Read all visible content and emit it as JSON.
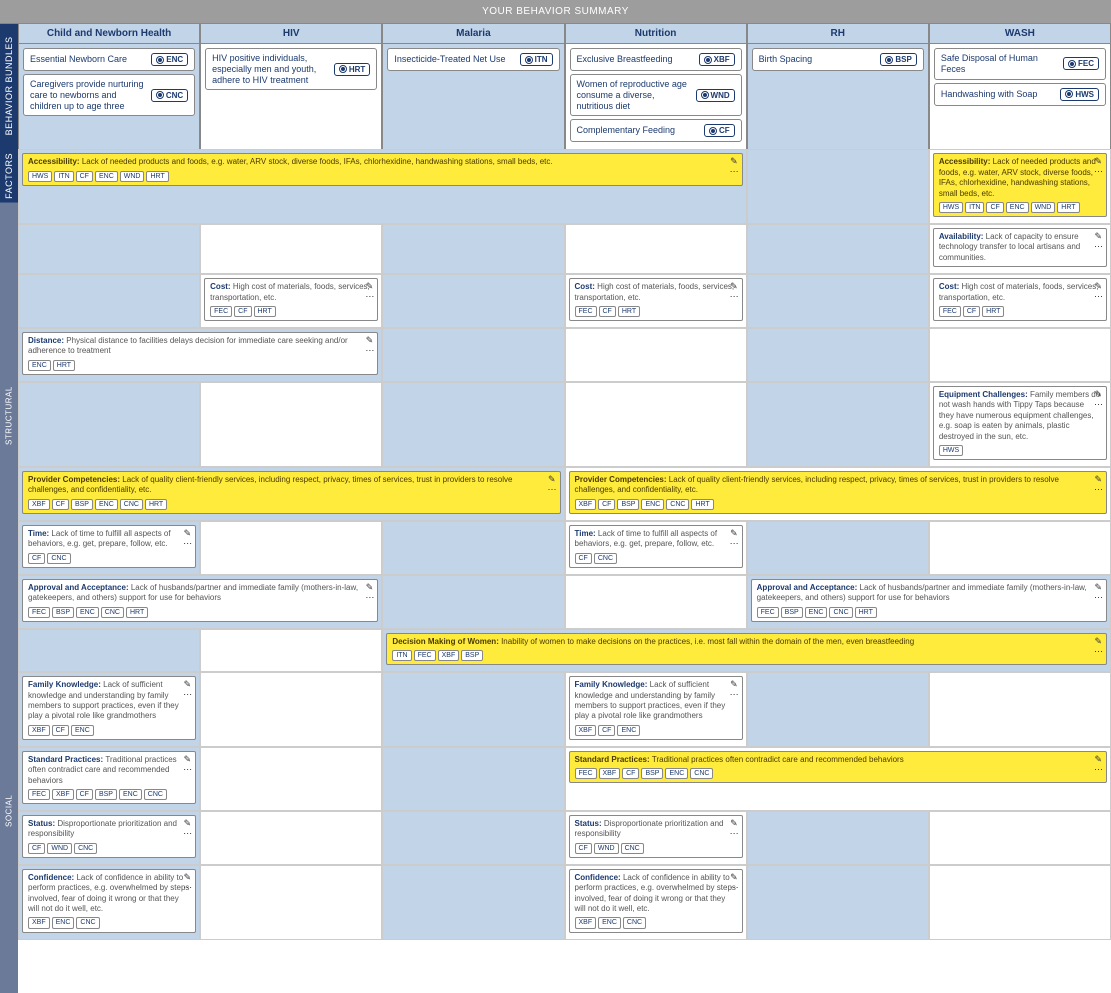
{
  "header": "YOUR BEHAVIOR SUMMARY",
  "side": {
    "bundles": "BEHAVIOR BUNDLES",
    "factors": "FACTORS",
    "structural": "STRUCTURAL",
    "social": "SOCIAL"
  },
  "columns": [
    {
      "name": "Child and Newborn Health",
      "alt": false,
      "bundles": [
        {
          "text": "Essential Newborn Care",
          "code": "ENC"
        },
        {
          "text": "Caregivers provide nurturing care to newborns and children up to age three",
          "code": "CNC"
        }
      ]
    },
    {
      "name": "HIV",
      "alt": true,
      "bundles": [
        {
          "text": "HIV positive individuals, especially men and youth, adhere to HIV treatment",
          "code": "HRT"
        }
      ]
    },
    {
      "name": "Malaria",
      "alt": false,
      "bundles": [
        {
          "text": "Insecticide-Treated Net Use",
          "code": "ITN"
        }
      ]
    },
    {
      "name": "Nutrition",
      "alt": true,
      "bundles": [
        {
          "text": "Exclusive Breastfeeding",
          "code": "XBF"
        },
        {
          "text": "Women of reproductive age consume a diverse, nutritious diet",
          "code": "WND"
        },
        {
          "text": "Complementary Feeding",
          "code": "CF"
        }
      ]
    },
    {
      "name": "RH",
      "alt": false,
      "bundles": [
        {
          "text": "Birth Spacing",
          "code": "BSP"
        }
      ]
    },
    {
      "name": "WASH",
      "alt": true,
      "bundles": [
        {
          "text": "Safe Disposal of Human Feces",
          "code": "FEC"
        },
        {
          "text": "Handwashing with Soap",
          "code": "HWS"
        }
      ]
    }
  ],
  "f": {
    "accessibility": {
      "t": "Accessibility:",
      "d": "Lack of needed products and foods, e.g. water, ARV stock, diverse foods, IFAs, chlorhexidine, handwashing stations, small beds, etc.",
      "tags": [
        "HWS",
        "ITN",
        "CF",
        "ENC",
        "WND",
        "HRT"
      ]
    },
    "availability": {
      "t": "Availability:",
      "d": "Lack of capacity to ensure technology transfer to local artisans and communities."
    },
    "cost": {
      "t": "Cost:",
      "d": "High cost of materials, foods, services, transportation, etc.",
      "tags": [
        "FEC",
        "CF",
        "HRT"
      ]
    },
    "distance": {
      "t": "Distance:",
      "d": "Physical distance to facilities delays decision for immediate care seeking and/or adherence to treatment",
      "tags": [
        "ENC",
        "HRT"
      ]
    },
    "equipment": {
      "t": "Equipment Challenges:",
      "d": "Family members do not wash hands with Tippy Taps because they have numerous equipment challenges, e.g. soap is eaten by animals, plastic destroyed in the sun, etc.",
      "tags": [
        "HWS"
      ]
    },
    "provider": {
      "t": "Provider Competencies:",
      "d": "Lack of quality client-friendly services, including respect, privacy, times of services, trust in providers to resolve challenges, and confidentiality, etc.",
      "tags": [
        "XBF",
        "CF",
        "BSP",
        "ENC",
        "CNC",
        "HRT"
      ]
    },
    "time": {
      "t": "Time:",
      "d": "Lack of time to fulfill all aspects of behaviors, e.g. get, prepare, follow, etc.",
      "tags": [
        "CF",
        "CNC"
      ]
    },
    "approval": {
      "t": "Approval and Acceptance:",
      "d": "Lack of husbands/partner and immediate family (mothers-in-law, gatekeepers, and others) support for use for behaviors",
      "tags": [
        "FEC",
        "BSP",
        "ENC",
        "CNC",
        "HRT"
      ]
    },
    "decision": {
      "t": "Decision Making of Women:",
      "d": "Inability of women to make decisions on the practices, i.e. most fall within the domain of the men, even breastfeeding",
      "tags": [
        "ITN",
        "FEC",
        "XBF",
        "BSP"
      ]
    },
    "family": {
      "t": "Family Knowledge:",
      "d": "Lack of sufficient knowledge and understanding by family members to support practices, even if they play a pivotal role like grandmothers",
      "tags": [
        "XBF",
        "CF",
        "ENC"
      ]
    },
    "standard": {
      "t": "Standard Practices:",
      "d": "Traditional practices often contradict care and recommended behaviors",
      "tags": [
        "FEC",
        "XBF",
        "CF",
        "BSP",
        "ENC",
        "CNC"
      ]
    },
    "status": {
      "t": "Status:",
      "d": "Disproportionate prioritization and responsibility",
      "tags": [
        "CF",
        "WND",
        "CNC"
      ]
    },
    "confidence": {
      "t": "Confidence:",
      "d": "Lack of confidence in ability to perform practices, e.g. overwhelmed by steps involved, fear of doing it wrong or that they will not do it well, etc.",
      "tags": [
        "XBF",
        "ENC",
        "CNC"
      ]
    }
  }
}
